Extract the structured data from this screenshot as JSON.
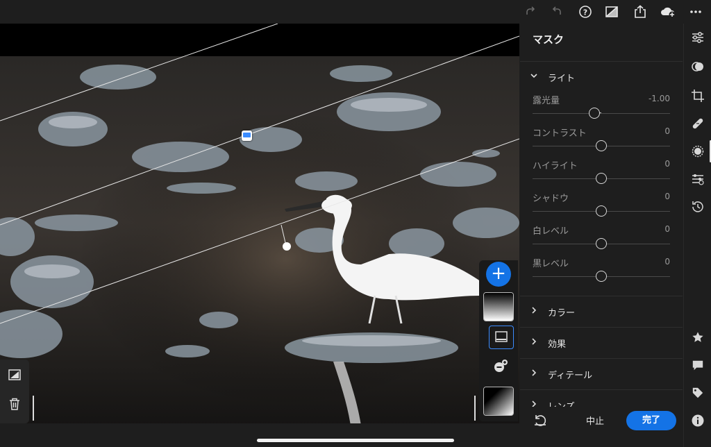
{
  "panel": {
    "title": "マスク",
    "light_section": "ライト",
    "sliders": [
      {
        "label": "露光量",
        "value": "-1.00",
        "fraction": 0.45
      },
      {
        "label": "コントラスト",
        "value": "0",
        "fraction": 0.5
      },
      {
        "label": "ハイライト",
        "value": "0",
        "fraction": 0.5
      },
      {
        "label": "シャドウ",
        "value": "0",
        "fraction": 0.5
      },
      {
        "label": "白レベル",
        "value": "0",
        "fraction": 0.5
      },
      {
        "label": "黒レベル",
        "value": "0",
        "fraction": 0.5
      }
    ],
    "sections": [
      "カラー",
      "効果",
      "ディテール",
      "レンズ"
    ]
  },
  "bottom": {
    "cancel_label": "中止",
    "done_label": "完了"
  },
  "topbar_icons": [
    "redo-icon",
    "undo-icon",
    "help-icon",
    "compare-icon",
    "share-icon",
    "cloud-sync-icon",
    "more-icon"
  ],
  "toolbar_icons": [
    "edit-sliders-icon",
    "presets-icon",
    "crop-icon",
    "healing-icon",
    "masking-icon",
    "versions-icon",
    "history-icon",
    "star-icon",
    "comment-icon",
    "tag-icon",
    "info-icon"
  ],
  "colors": {
    "accent": "#1473e6",
    "panel_bg": "#1e1e1e",
    "canvas_bg": "#000000"
  }
}
